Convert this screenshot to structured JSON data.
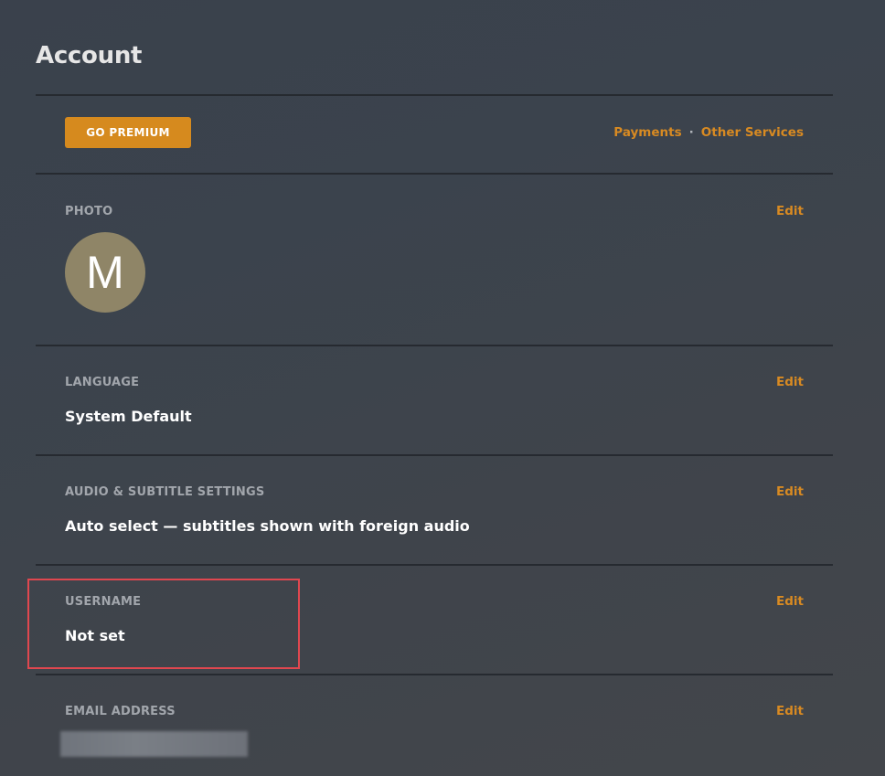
{
  "page": {
    "title": "Account"
  },
  "top_bar": {
    "premium_label": "GO PREMIUM",
    "payments_label": "Payments",
    "separator": "·",
    "other_services_label": "Other Services"
  },
  "sections": {
    "photo": {
      "label": "PHOTO",
      "edit_label": "Edit",
      "avatar_initial": "M"
    },
    "language": {
      "label": "LANGUAGE",
      "edit_label": "Edit",
      "value": "System Default"
    },
    "audio_subtitle": {
      "label": "AUDIO & SUBTITLE SETTINGS",
      "edit_label": "Edit",
      "value": "Auto select — subtitles shown with foreign audio"
    },
    "username": {
      "label": "USERNAME",
      "edit_label": "Edit",
      "value": "Not set"
    },
    "email": {
      "label": "EMAIL ADDRESS",
      "edit_label": "Edit"
    }
  },
  "colors": {
    "accent": "#d88a22",
    "premium_button": "#d68a1e",
    "highlight_border": "#e0474f",
    "avatar_bg": "#8f8567"
  }
}
